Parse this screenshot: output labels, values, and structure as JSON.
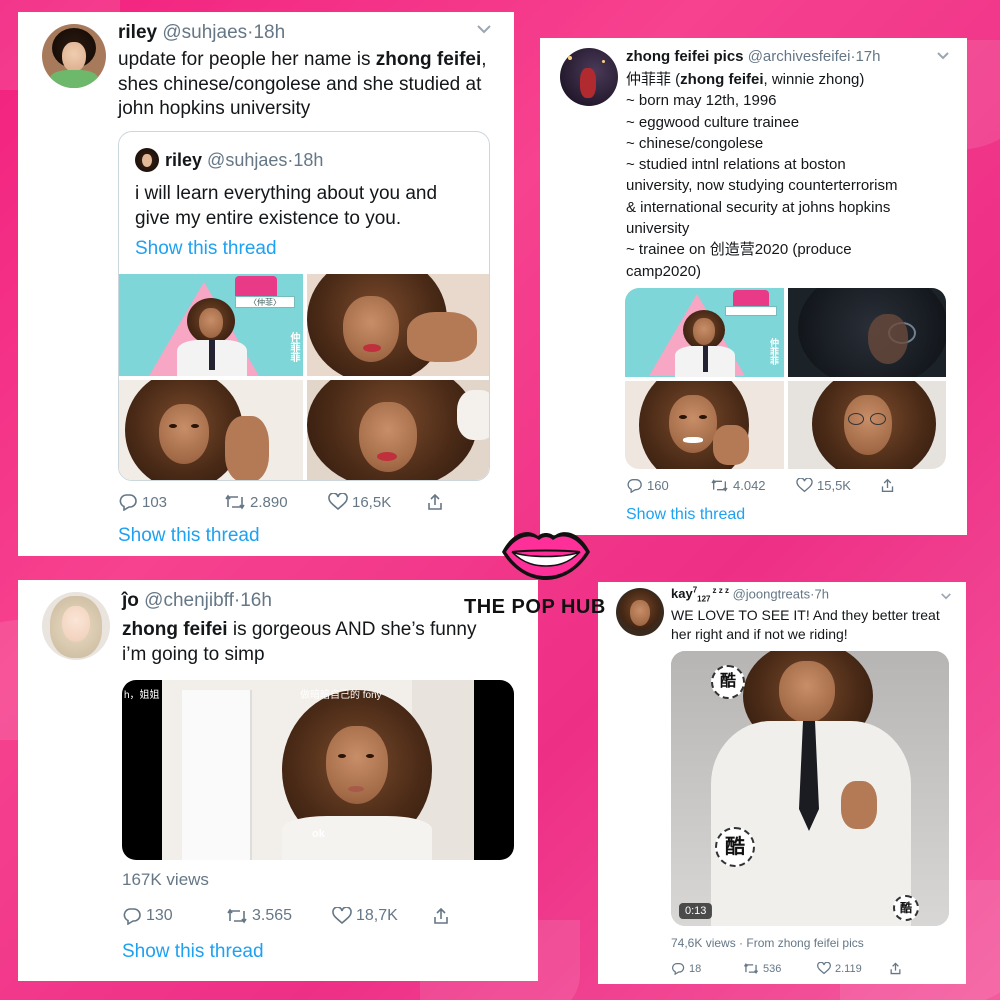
{
  "brand": {
    "name": "THE POP HUB",
    "accent": "#f2207e"
  },
  "tweets": [
    {
      "name": "riley",
      "handle": "@suhjaes",
      "time": "18h",
      "text_parts": [
        "update for people her name is ",
        "zhong feifei",
        ", shes chinese/congolese and she studied at john hopkins university"
      ],
      "quote": {
        "name": "riley",
        "handle": "@suhjaes",
        "time": "18h",
        "text": "i will learn everything about you and give my entire existence to you.",
        "link": "Show this thread"
      },
      "replies": "103",
      "retweets": "2.890",
      "likes": "16,5K",
      "link": "Show this thread"
    },
    {
      "name": "zhong feifei pics",
      "handle": "@archivesfeifei",
      "time": "17h",
      "lines": [
        {
          "pre": "仲菲菲 (",
          "bold": "zhong feifei",
          "post": ", winnie zhong)"
        },
        {
          "pre": "~ born may 12th, 1996",
          "bold": "",
          "post": ""
        },
        {
          "pre": "~ eggwood culture trainee",
          "bold": "",
          "post": ""
        },
        {
          "pre": "~ chinese/congolese",
          "bold": "",
          "post": ""
        },
        {
          "pre": "~ studied intnl relations at boston",
          "bold": "",
          "post": ""
        },
        {
          "pre": "university, now studying counterterrorism",
          "bold": "",
          "post": ""
        },
        {
          "pre": "& international security at johns hopkins",
          "bold": "",
          "post": ""
        },
        {
          "pre": "university",
          "bold": "",
          "post": ""
        },
        {
          "pre": "~ trainee on 创造营2020 (produce",
          "bold": "",
          "post": ""
        },
        {
          "pre": "camp2020)",
          "bold": "",
          "post": ""
        }
      ],
      "replies": "160",
      "retweets": "4.042",
      "likes": "15,5K",
      "link": "Show this thread"
    },
    {
      "name": "ĵo",
      "handle": "@chenjibff",
      "time": "16h",
      "text_bold": "zhong feifei",
      "text_rest": " is gorgeous AND she’s funny",
      "text_line2": "i’m going to simp",
      "video_caption_left": "h，姐姐",
      "video_caption_top": "做暗暗自己的 fony",
      "video_caption_mid": "ok",
      "views": "167K views",
      "replies": "130",
      "retweets": "3.565",
      "likes": "18,7K",
      "link": "Show this thread"
    },
    {
      "name": "kay",
      "name_sup": "7",
      "name_sub": "127",
      "name_z": "z z z",
      "handle": "@joongtreats",
      "time": "7h",
      "text": "WE LOVE TO SEE IT! And they better treat her right and if not we riding!",
      "duration": "0:13",
      "views_line": "74,6K views · From zhong feifei pics",
      "replies": "18",
      "retweets": "536",
      "likes": "2.119",
      "stamp": "酷"
    }
  ],
  "show_label": "仲菲菲"
}
